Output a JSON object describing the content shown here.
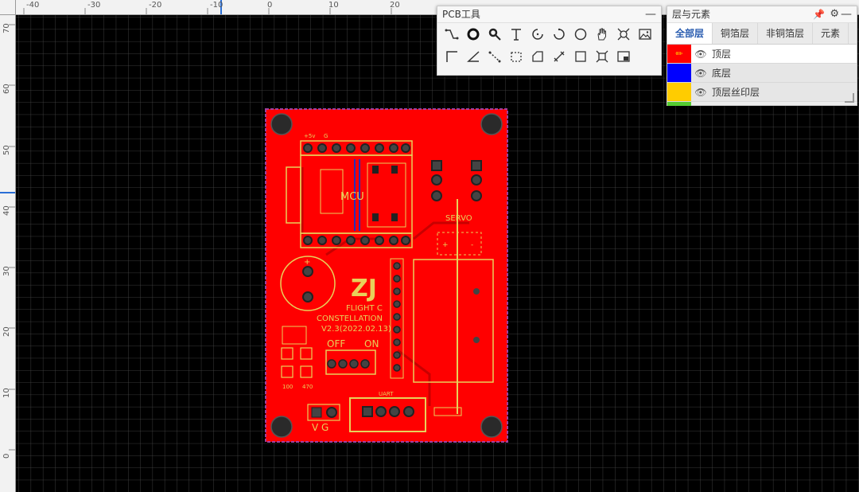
{
  "rulers": {
    "top_labels": [
      "-40",
      "-30",
      "-20",
      "-10",
      "0",
      "10",
      "20"
    ],
    "left_labels": [
      "70",
      "60",
      "50",
      "40",
      "30",
      "20",
      "10",
      "0"
    ]
  },
  "pcb": {
    "board_color": "#ff0000",
    "silk_color": "#e8d05a",
    "silk": {
      "power_label": "+5v",
      "ground_label": "G",
      "mcu_label": "MCU",
      "servo_label": "SERVO",
      "logo_glyph": "ZJ",
      "title_line1": "FLIGHT C",
      "title_line2": "CONSTELLATION",
      "version": "V2.3(2022.02.13)",
      "switch_off": "OFF",
      "switch_on": "ON",
      "resistor_100": "100",
      "resistor_470": "470",
      "uart_label": "UART",
      "vg_label": "V G",
      "plus": "+",
      "minus": "-"
    }
  },
  "pcb_tools": {
    "title": "PCB工具",
    "minimize": "—",
    "row1": [
      "wire-icon",
      "via-icon",
      "pad-icon",
      "text-icon",
      "arc-center-icon",
      "arc-3pt-icon",
      "circle-icon",
      "pan-hand-icon",
      "snap-icon",
      "image-icon"
    ],
    "row2": [
      "corner-icon",
      "angle-icon",
      "measure-icon",
      "rect-dashed-icon",
      "polygon-icon",
      "dimension-icon",
      "square-icon",
      "select-box-icon",
      "layout-icon"
    ]
  },
  "layers_panel": {
    "title": "层与元素",
    "tabs": [
      "全部层",
      "铜箔层",
      "非铜箔层",
      "元素"
    ],
    "active_tab": 0,
    "layers": [
      {
        "name": "顶层",
        "color": "#ff0000"
      },
      {
        "name": "底层",
        "color": "#0000ff"
      },
      {
        "name": "顶层丝印层",
        "color": "#ffcc00"
      }
    ]
  }
}
